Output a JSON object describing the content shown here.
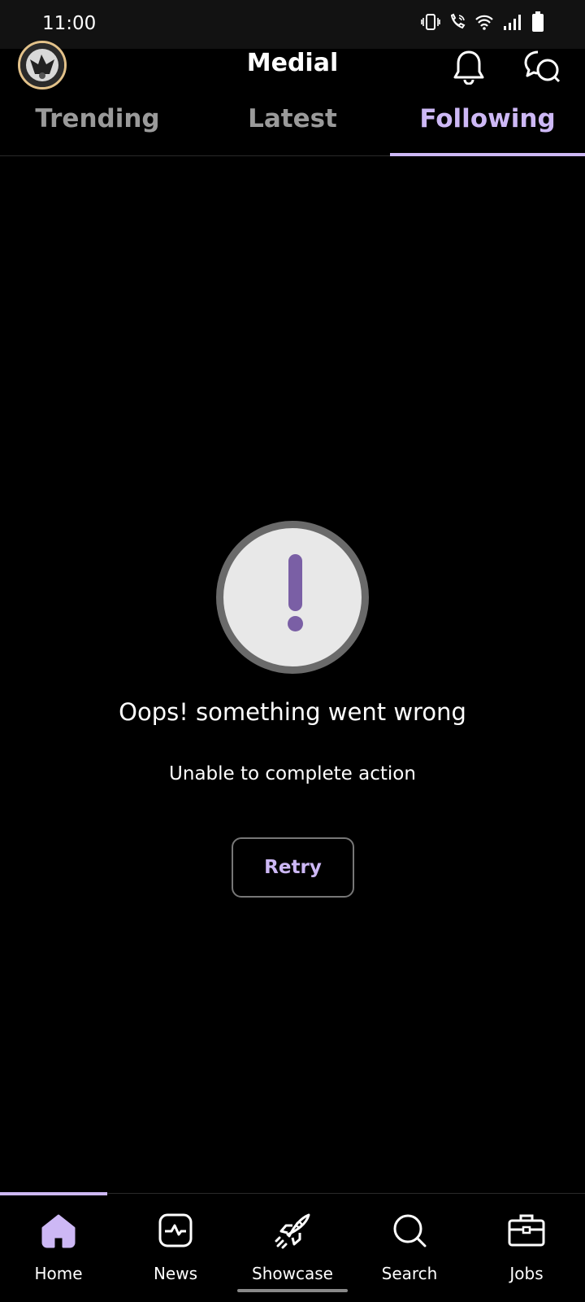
{
  "status": {
    "time": "11:00",
    "icons": [
      "vibrate-icon",
      "wifi-call-icon",
      "wifi-icon",
      "signal-icon",
      "battery-icon"
    ]
  },
  "header": {
    "title": "Medial",
    "avatar_icon": "avatar",
    "notification_icon": "bell-icon",
    "messages_icon": "chat-icon"
  },
  "tabs": [
    {
      "label": "Trending",
      "active": false
    },
    {
      "label": "Latest",
      "active": false
    },
    {
      "label": "Following",
      "active": true
    }
  ],
  "error": {
    "icon": "exclamation-icon",
    "title": "Oops! something went wrong",
    "subtitle": "Unable to complete action",
    "retry_label": "Retry"
  },
  "nav": {
    "items": [
      {
        "label": "Home",
        "icon": "home-icon",
        "active": true
      },
      {
        "label": "News",
        "icon": "news-icon",
        "active": false
      },
      {
        "label": "Showcase",
        "icon": "rocket-icon",
        "active": false
      },
      {
        "label": "Search",
        "icon": "search-icon",
        "active": false
      },
      {
        "label": "Jobs",
        "icon": "briefcase-icon",
        "active": false
      }
    ]
  },
  "colors": {
    "accent": "#cdb8f5",
    "error_icon": "#7a5fa5",
    "avatar_ring": "#e3c28a",
    "background": "#000000"
  }
}
